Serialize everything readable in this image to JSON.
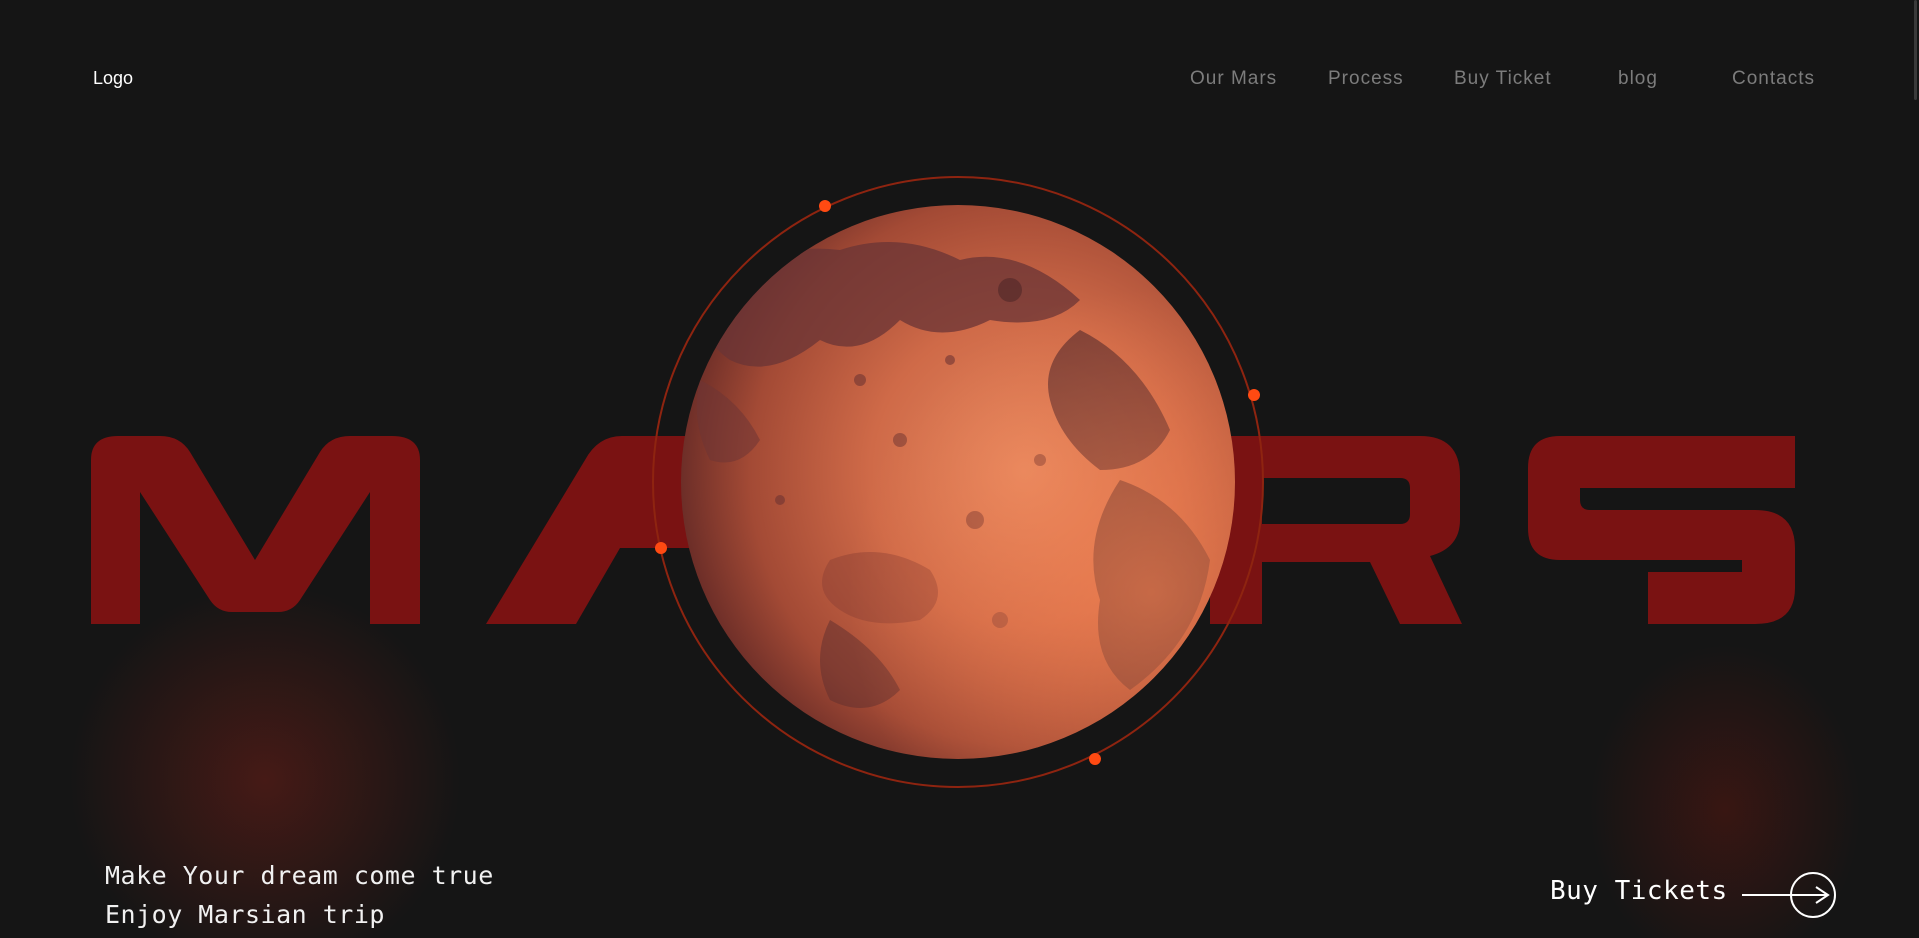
{
  "header": {
    "logo": "Logo",
    "nav": [
      "Our Mars",
      "Process",
      "Buy Ticket",
      "blog",
      "Contacts"
    ]
  },
  "hero": {
    "title": "MARS",
    "colors": {
      "title": "#7a1212",
      "orbit": "#9a2a12",
      "orbit_dot": "#ff4a12",
      "planet_light": "#e27a55",
      "planet_dark": "#5a2c2a"
    }
  },
  "tagline": {
    "line1": "Make Your dream come true",
    "line2": "Enjoy Marsian trip"
  },
  "cta": {
    "label": "Buy Tickets",
    "icon": "arrow-right-circle-icon"
  }
}
